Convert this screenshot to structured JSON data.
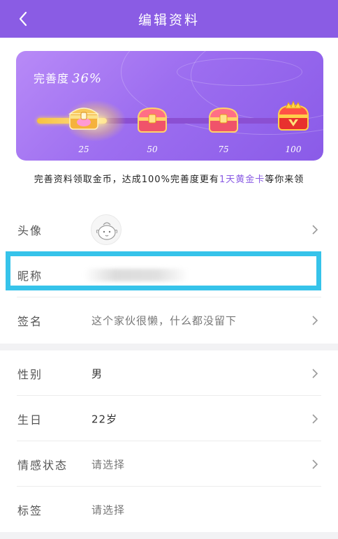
{
  "header": {
    "title": "编辑资料",
    "back_icon": "chevron-left-icon"
  },
  "card": {
    "label": "完善度",
    "percent": "36%",
    "progress_value": 36,
    "milestones": [
      {
        "label": "25",
        "icon": "treasure-chest-icon",
        "reached": true
      },
      {
        "label": "50",
        "icon": "treasure-chest-icon",
        "reached": false
      },
      {
        "label": "75",
        "icon": "treasure-chest-icon",
        "reached": false
      },
      {
        "label": "100",
        "icon": "crown-treasure-chest-icon",
        "reached": false
      }
    ]
  },
  "tip": {
    "prefix": "完善资料领取金币，达成100%完善度更有",
    "highlight": "1天黄金卡",
    "suffix": "等你来领"
  },
  "rows": {
    "avatar": {
      "label": "头像",
      "icon": "avatar-icon"
    },
    "nickname": {
      "label": "昵称"
    },
    "signature": {
      "label": "签名",
      "value": "这个家伙很懒，什么都没留下"
    },
    "gender": {
      "label": "性别",
      "value": "男"
    },
    "birthday": {
      "label": "生日",
      "value": "22岁"
    },
    "relationship": {
      "label": "情感状态",
      "value": "请选择"
    },
    "tags": {
      "label": "标签",
      "value": "请选择"
    }
  },
  "colors": {
    "header": "#8a5ce4",
    "highlight_border": "#36c3ea",
    "gold": "#f7c241"
  }
}
